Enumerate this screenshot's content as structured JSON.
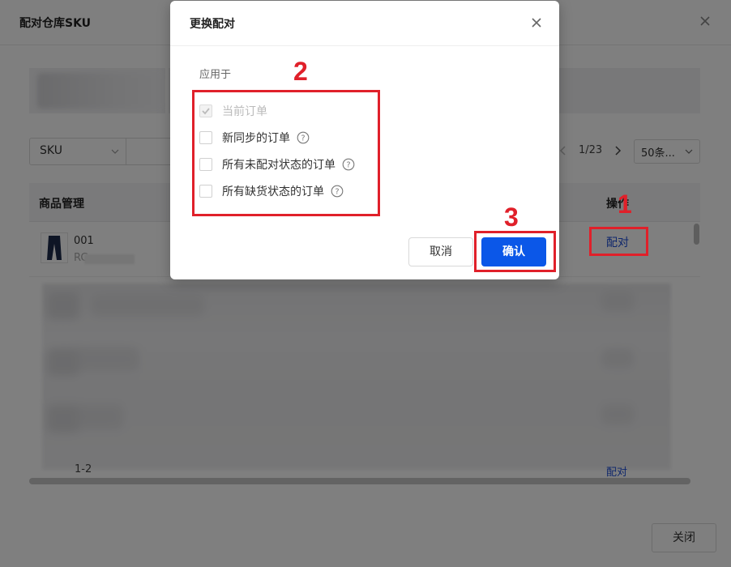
{
  "background_dialog": {
    "title": "配对仓库SKU",
    "search_field": {
      "selected": "SKU"
    },
    "pagination": {
      "page_indicator": "1/23",
      "page_size": "50条..."
    },
    "table": {
      "headers": {
        "product": "商品管理",
        "operations": "操作"
      },
      "row": {
        "sku_code": "001",
        "sub_text": "RC",
        "action": "配对"
      },
      "last_row": {
        "text": "1-2",
        "action": "配对"
      }
    },
    "close_button": "关闭"
  },
  "modal": {
    "title": "更换配对",
    "apply_label": "应用于",
    "options": [
      {
        "label": "当前订单",
        "checked": true,
        "disabled": true
      },
      {
        "label": "新同步的订单",
        "checked": false
      },
      {
        "label": "所有未配对状态的订单",
        "checked": false
      },
      {
        "label": "所有缺货状态的订单",
        "checked": false
      }
    ],
    "cancel_label": "取消",
    "confirm_label": "确认"
  },
  "annotations": {
    "step_1": "1",
    "step_2": "2",
    "step_3": "3",
    "color": "#e0202a"
  },
  "colors": {
    "primary": "#0b57e8",
    "link": "#1f4fd8"
  }
}
